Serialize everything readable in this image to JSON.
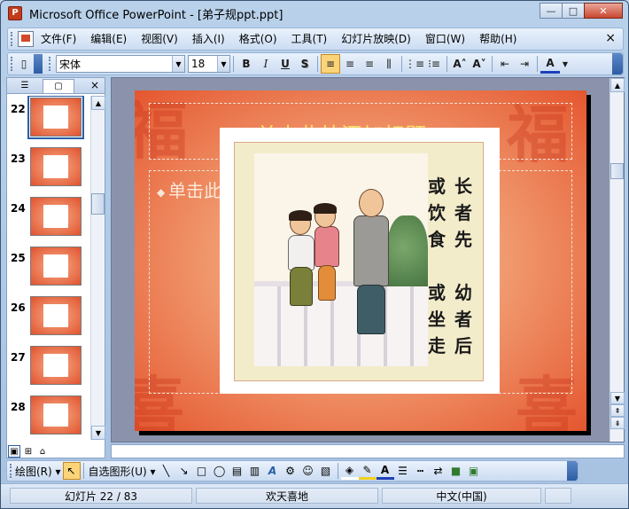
{
  "window": {
    "title": "Microsoft Office PowerPoint - [弟子规ppt.ppt]",
    "app_icon_letter": "P",
    "btn_minimize": "—",
    "btn_maximize": "□",
    "btn_close": "✕"
  },
  "menubar": {
    "items": [
      "文件(F)",
      "编辑(E)",
      "视图(V)",
      "插入(I)",
      "格式(O)",
      "工具(T)",
      "幻灯片放映(D)",
      "窗口(W)",
      "帮助(H)"
    ],
    "close_glyph": "×"
  },
  "format_toolbar": {
    "font_name": "宋体",
    "font_size": "18",
    "bold": "B",
    "italic": "I",
    "underline": "U",
    "shadow": "S",
    "align_left": "≡",
    "align_center": "≡",
    "align_right": "≡",
    "distribute": "⫼",
    "numbering": "⋮≡",
    "bullets": "⁝≡",
    "increase_font": "A˄",
    "decrease_font": "A˅",
    "decrease_indent": "⇤",
    "increase_indent": "⇥",
    "font_color": "A",
    "new_doc": "▯"
  },
  "left_panel": {
    "tab_outline": "☰",
    "tab_slides": "▢",
    "close_glyph": "×",
    "thumbnails": [
      {
        "number": "22",
        "selected": true
      },
      {
        "number": "23",
        "selected": false
      },
      {
        "number": "24",
        "selected": false
      },
      {
        "number": "25",
        "selected": false
      },
      {
        "number": "26",
        "selected": false
      },
      {
        "number": "27",
        "selected": false
      },
      {
        "number": "28",
        "selected": false
      }
    ],
    "view_normal": "▣",
    "view_sorter": "⊞",
    "view_show": "⌂"
  },
  "slide": {
    "title_placeholder": "单击此处添加标题",
    "body_placeholder": "单击此",
    "poem_right": "长者先",
    "poem_left": "或饮食",
    "poem_right_2": "幼者后",
    "poem_left_2": "或坐走"
  },
  "scrollbar": {
    "up": "▲",
    "down": "▼",
    "prev_slide": "⇞",
    "next_slide": "⇟"
  },
  "drawing_toolbar": {
    "draw_menu": "绘图(R) ▾",
    "select_arrow": "↖",
    "autoshapes": "自选图形(U) ▾",
    "line": "╲",
    "arrow": "↘",
    "rectangle": "□",
    "oval": "◯",
    "textbox": "▤",
    "vertical_textbox": "▥",
    "wordart": "A",
    "diagram": "⚙",
    "clipart": "☺",
    "picture": "▧",
    "fill_color": "◈",
    "line_color": "✎",
    "font_color": "A",
    "line_style": "☰",
    "dash_style": "┅",
    "arrow_style": "⇄",
    "shadow": "■",
    "three_d": "▣"
  },
  "statusbar": {
    "slide_position": "幻灯片 22 / 83",
    "design_template": "欢天喜地",
    "language": "中文(中国)"
  },
  "colors": {
    "slide_accent": "#e4562f",
    "title_text": "#f8e06a",
    "selection": "#2b5ea7"
  }
}
